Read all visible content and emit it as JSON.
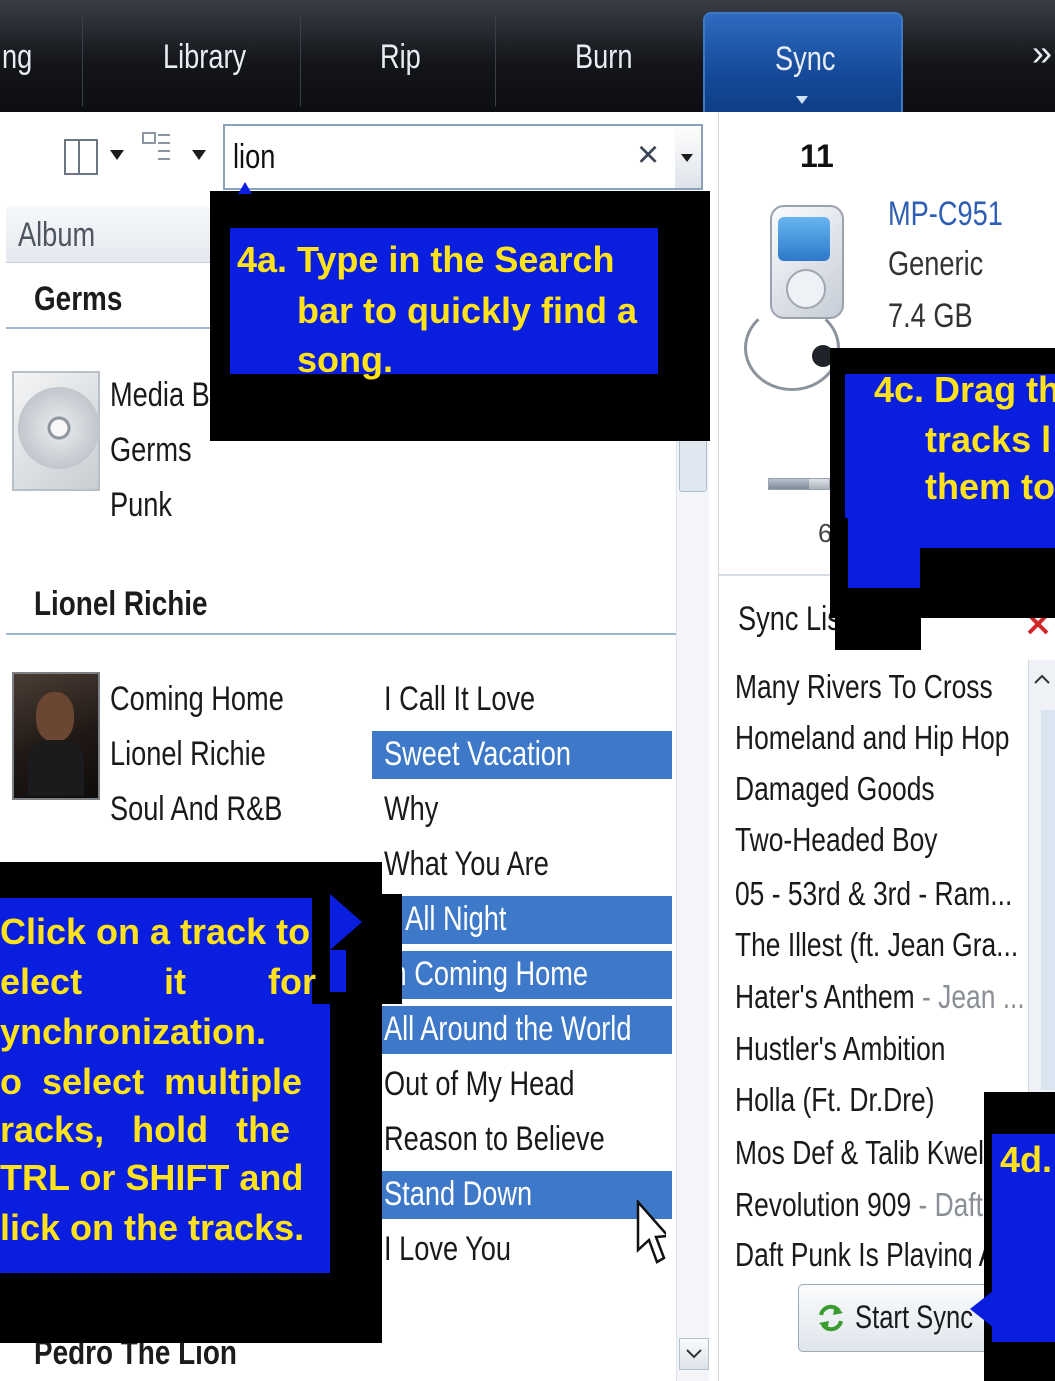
{
  "nav": {
    "tabs": [
      "ng",
      "Library",
      "Rip",
      "Burn",
      "Sync"
    ],
    "more_glyph": "»"
  },
  "toolbar": {
    "search_value": "lion",
    "clear_glyph": "×"
  },
  "columns": {
    "album_header": "Album"
  },
  "library": {
    "groups": [
      {
        "name": "Germs",
        "album_lines": [
          "Media Bl",
          "Germs",
          "Punk"
        ]
      },
      {
        "name": "Lionel Richie",
        "album_lines": [
          "Coming Home",
          "Lionel Richie",
          "Soul And R&B"
        ],
        "tracks": [
          {
            "title": "I Call It Love",
            "selected": false
          },
          {
            "title": "Sweet Vacation",
            "selected": true
          },
          {
            "title": "Why",
            "selected": false
          },
          {
            "title": "What You Are",
            "selected": false
          },
          {
            "title": "p All Night",
            "selected": true
          },
          {
            "title": "m Coming Home",
            "selected": true
          },
          {
            "title": "All Around the World",
            "selected": true
          },
          {
            "title": "Out of My Head",
            "selected": false
          },
          {
            "title": "Reason to Believe",
            "selected": false
          },
          {
            "title": "Stand Down",
            "selected": true
          },
          {
            "title": "I Love You",
            "selected": false
          }
        ]
      },
      {
        "name": "Pedro The Lion"
      }
    ]
  },
  "device": {
    "number": "11",
    "name": "MP-C951",
    "maker": "Generic",
    "capacity": "7.4 GB",
    "partial_text": "6"
  },
  "sync_list": {
    "title": "Sync Lis",
    "items": [
      {
        "title": "Many Rivers To Cross",
        "artist": ""
      },
      {
        "title": "Homeland and Hip Hop",
        "artist": ""
      },
      {
        "title": "Damaged Goods",
        "artist": ""
      },
      {
        "title": "Two-Headed Boy",
        "artist": ""
      },
      {
        "title": "05 - 53rd & 3rd - Ram...",
        "artist": ""
      },
      {
        "title": "The Illest (ft. Jean Gra...",
        "artist": ""
      },
      {
        "title": "Hater's Anthem",
        "artist": " - Jean ..."
      },
      {
        "title": "Hustler's Ambition",
        "artist": ""
      },
      {
        "title": "Holla (Ft. Dr.Dre)",
        "artist": ""
      },
      {
        "title": "Mos Def & Talib Kweli",
        "artist": ""
      },
      {
        "title": "Revolution 909",
        "artist": " - Daft"
      },
      {
        "title": "Daft Punk Is Playing A",
        "artist": ""
      }
    ],
    "start_sync_label": "Start Sync"
  },
  "callouts": {
    "c4a": [
      "4a. Type in the Search",
      "bar to quickly find a",
      "song."
    ],
    "c4b": [
      "Click on a track to",
      "elect it for",
      "ynchronization.",
      "o select multiple",
      "racks, hold the",
      "TRL or SHIFT and",
      "lick on the tracks."
    ],
    "c4c": [
      "4c. Drag th",
      "tracks l",
      "them to"
    ],
    "c4d": "4d."
  },
  "colors": {
    "callout_fill": "#0a1ee0",
    "callout_text": "#ffe31a",
    "selection": "#3e78c9"
  }
}
